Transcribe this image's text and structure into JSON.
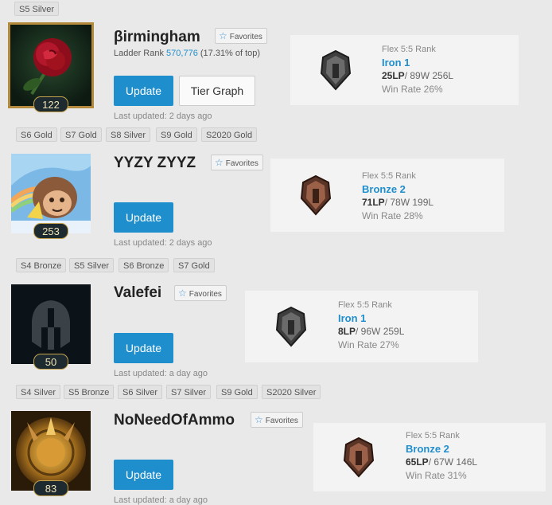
{
  "top_season_tags": [
    "S5 Silver"
  ],
  "profiles": [
    {
      "name": "βirmingham",
      "favorites_label": "Favorites",
      "ladder_prefix": "Ladder Rank ",
      "ladder_rank": "570,776",
      "ladder_suffix": " (17.31% of top)",
      "level": "122",
      "update_label": "Update",
      "tier_graph_label": "Tier Graph",
      "last_updated": "Last updated: 2 days ago",
      "queue": "Flex 5:5 Rank",
      "tier": "Iron 1",
      "lp": "25LP",
      "wl": "/ 89W 256L",
      "win_rate": "Win Rate 26%",
      "season_tags": [
        "S6 Gold",
        "S7 Gold",
        "S8 Silver",
        "S9 Gold",
        "S2020 Gold"
      ]
    },
    {
      "name": "YYZY ZYYZ",
      "favorites_label": "Favorites",
      "level": "253",
      "update_label": "Update",
      "last_updated": "Last updated: 2 days ago",
      "queue": "Flex 5:5 Rank",
      "tier": "Bronze 2",
      "lp": "71LP",
      "wl": "/ 78W 199L",
      "win_rate": "Win Rate 28%",
      "season_tags": [
        "S4 Bronze",
        "S5 Silver",
        "S6 Bronze",
        "S7 Gold"
      ]
    },
    {
      "name": "Valefei",
      "favorites_label": "Favorites",
      "level": "50",
      "update_label": "Update",
      "last_updated": "Last updated: a day ago",
      "queue": "Flex 5:5 Rank",
      "tier": "Iron 1",
      "lp": "8LP",
      "wl": "/ 96W 259L",
      "win_rate": "Win Rate 27%",
      "season_tags": [
        "S4 Silver",
        "S5 Bronze",
        "S6 Silver",
        "S7 Silver",
        "S9 Gold",
        "S2020 Silver"
      ]
    },
    {
      "name": "NoNeedOfAmmo",
      "favorites_label": "Favorites",
      "level": "83",
      "update_label": "Update",
      "last_updated": "Last updated: a day ago",
      "queue": "Flex 5:5 Rank",
      "tier": "Bronze 2",
      "lp": "65LP",
      "wl": "/ 67W 146L",
      "win_rate": "Win Rate 31%"
    }
  ],
  "colors": {
    "accent": "#1f8ecd",
    "iron_emblem": "#5a5a5a",
    "bronze_emblem": "#7a4a38"
  },
  "icons": {
    "favorite": "star-outline-icon",
    "avatar_1": "rose-icon",
    "avatar_2": "champion-portrait-icon",
    "avatar_3": "default-helmet-icon",
    "avatar_4": "golden-emblem-icon",
    "tier_iron": "iron-emblem-icon",
    "tier_bronze": "bronze-emblem-icon"
  }
}
